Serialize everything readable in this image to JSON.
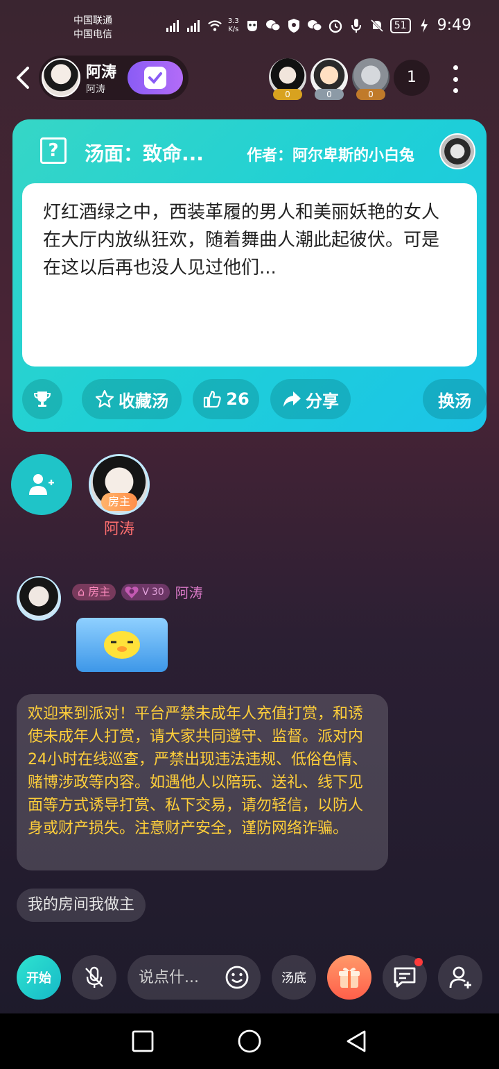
{
  "status_bar": {
    "carrier1": "中国联通",
    "carrier2": "中国电信",
    "net_speed_value": "3.3",
    "net_speed_unit": "K/s",
    "battery": "51",
    "time": "9:49"
  },
  "header": {
    "host_name": "阿涛",
    "host_sub": "阿涛",
    "viewers": [
      {
        "badge": "0",
        "badge_color": "#d8a21f"
      },
      {
        "badge": "0",
        "badge_color": "#8c9aa6"
      },
      {
        "badge": "0",
        "badge_color": "#c07a2a"
      }
    ],
    "viewer_count": "1"
  },
  "card": {
    "title": "汤面：致命...",
    "author": "作者：阿尔卑斯的小白兔",
    "body": "灯红酒绿之中，西装革履的男人和美丽妖艳的女人在大厅内放纵狂欢，随着舞曲人潮此起彼伏。可是在这以后再也没人见过他们...",
    "favorite_label": "收藏汤",
    "like_count": "26",
    "share_label": "分享",
    "change_label": "换汤"
  },
  "seat": {
    "role": "房主",
    "name": "阿涛"
  },
  "message": {
    "role_tag": "房主",
    "level": "30",
    "name": "阿涛"
  },
  "notice": "欢迎来到派对！平台严禁未成年人充值打赏，和诱使未成年人打赏，请大家共同遵守、监督。派对内24小时在线巡查，严禁出现违法违规、低俗色情、赌博涉政等内容。如遇他人以陪玩、送礼、线下见面等方式诱导打赏、私下交易，请勿轻信，以防人身或财产损失。注意财产安全，谨防网络诈骗。",
  "chip": "我的房间我做主",
  "bottom": {
    "start_label": "开始",
    "input_placeholder": "说点什...",
    "soup_label": "汤底"
  },
  "colors": {
    "card_accent": "#1fd0d6",
    "notice_text": "#ffcf3a",
    "host_name": "#ff6f6f"
  }
}
